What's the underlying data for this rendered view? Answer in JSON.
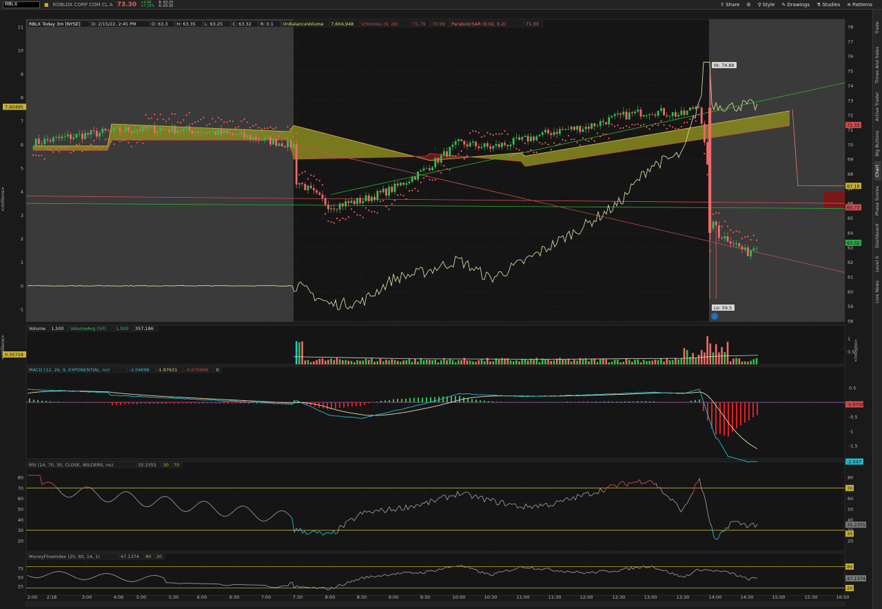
{
  "toolbar": {
    "symbol": "RBLX",
    "company": "ROBLOX CORP COM CL A",
    "last_price": "73.30",
    "change": "+4.98",
    "change_pct": "+7.29%",
    "bid": "B: 63.25",
    "ask": "A: 63.30",
    "buttons": [
      "Share",
      "Style",
      "Drawings",
      "Studies",
      "Patterns"
    ]
  },
  "sidebar": {
    "tabs": [
      "Trade",
      "Times And Sales",
      "Active Trader",
      "Big Buttons",
      "Chart",
      "Phase Scores",
      "Dashboard",
      "Level II",
      "Live News"
    ]
  },
  "price_panel": {
    "header": [
      "RBLX Today 3m [NYSE]",
      "D: 2/15/22, 2:45 PM",
      "O: 63.3",
      "H: 63.35",
      "L: 63.25",
      "C: 63.32",
      "R: 0.1",
      "OnBalanceVolume",
      "7,604,948",
      "Ichimoku (9, 26)",
      "71.79",
      "70.99",
      "ParabolicSAR (0.02, 0.2)",
      "71.33"
    ],
    "left_axis_label": "<millions>",
    "left_ticks": [
      "11",
      "10",
      "9",
      "8",
      "7",
      "6",
      "5",
      "4",
      "3",
      "2",
      "1",
      "0",
      "-1"
    ],
    "left_marker": "7.60495",
    "right_ticks": [
      "78",
      "77",
      "76",
      "75",
      "74",
      "73",
      "72",
      "71",
      "70",
      "69",
      "68",
      "67",
      "66",
      "65",
      "64",
      "63",
      "62",
      "61",
      "60",
      "59",
      "58"
    ],
    "right_markers": [
      {
        "label": "71.33",
        "color": "#d04a4a"
      },
      {
        "label": "67.19",
        "color": "#c8b230"
      },
      {
        "label": "65.73",
        "color": "#d04a4a"
      },
      {
        "label": "63.32",
        "color": "#2aa84a"
      }
    ],
    "hi_label": "Hi: 74.88",
    "lo_label": "Lo: 59.5"
  },
  "volume_panel": {
    "header": [
      "Volume",
      "1,500",
      "VolumeAvg (50)",
      "1,500",
      "357,186"
    ],
    "left_axis_label": "<millions>",
    "left_marker": "0.35719",
    "right_axis_label": "<millions>",
    "right_ticks": [
      "1",
      "0.5"
    ]
  },
  "macd_panel": {
    "header": [
      "MACD (12, 26, 9, EXPONENTIAL, no)",
      "-2.04698",
      "-1.97631",
      "-0.070666",
      "0"
    ],
    "right_ticks": [
      "0.5",
      "0",
      "-0.5",
      "-1",
      "-1.5",
      "-2"
    ],
    "right_markers": [
      {
        "label": "-0.0706",
        "color": "#d04a4a"
      },
      {
        "label": "-2.047",
        "color": "#27b6c8"
      }
    ]
  },
  "rsi_panel": {
    "header": [
      "RSI (14, 70, 30, CLOSE, WILDERS, no)",
      "35.2355",
      "30",
      "70"
    ],
    "right_ticks": [
      "80",
      "70",
      "60",
      "50",
      "40",
      "30",
      "20"
    ],
    "left_ticks": [
      "80",
      "70",
      "60",
      "50",
      "40",
      "30",
      "20"
    ],
    "right_markers": [
      {
        "label": "70",
        "color": "#c8b230"
      },
      {
        "label": "35.2355",
        "color": "#777777"
      },
      {
        "label": "30",
        "color": "#c8b230"
      }
    ]
  },
  "mfi_panel": {
    "header": [
      "MoneyFlowIndex (20, 80, 14, 1)",
      "47.1374",
      "80",
      "20"
    ],
    "left_ticks": [
      "75",
      "50",
      "25"
    ],
    "right_markers": [
      {
        "label": "80",
        "color": "#c8b230"
      },
      {
        "label": "47.1374",
        "color": "#777777"
      },
      {
        "label": "20",
        "color": "#c8b230"
      }
    ]
  },
  "time_axis": [
    "2:00",
    "2:18",
    "3:00",
    "4:06",
    "5:00",
    "5:30",
    "6:00",
    "6:30",
    "7:00",
    "7:30",
    "8:00",
    "8:30",
    "9:00",
    "9:30",
    "10:00",
    "10:30",
    "11:00",
    "11:30",
    "12:00",
    "12:30",
    "13:00",
    "13:30",
    "14:00",
    "14:30",
    "15:00",
    "15:30",
    "16:00"
  ],
  "chart_data": {
    "type": "line",
    "title": "RBLX Today 3m [NYSE]",
    "x": [
      "7:30",
      "8:00",
      "8:30",
      "9:00",
      "9:30",
      "10:00",
      "10:30",
      "11:00",
      "11:30",
      "12:00",
      "12:30",
      "13:00",
      "13:30",
      "13:45",
      "14:00",
      "14:15",
      "14:30",
      "14:40"
    ],
    "series": [
      {
        "name": "Price close",
        "values": [
          67.5,
          65.8,
          66.2,
          67.0,
          68.3,
          70.1,
          69.8,
          70.3,
          70.9,
          71.2,
          71.9,
          72.3,
          72.0,
          72.8,
          64.0,
          63.5,
          62.6,
          63.32
        ]
      },
      {
        "name": "OnBalanceVolume (millions)",
        "values": [
          0.0,
          -0.8,
          -0.7,
          0.3,
          0.6,
          1.1,
          0.3,
          1.0,
          1.8,
          2.6,
          3.5,
          5.1,
          5.6,
          7.9,
          7.7,
          7.6,
          7.7,
          7.605
        ]
      },
      {
        "name": "RSI",
        "values": [
          30,
          25,
          46,
          50,
          55,
          65,
          58,
          52,
          55,
          64,
          73,
          78,
          48,
          79,
          18,
          38,
          35,
          35.2355
        ]
      },
      {
        "name": "MACD",
        "values": [
          0.05,
          -0.45,
          -0.55,
          -0.3,
          -0.05,
          0.3,
          0.25,
          0.2,
          0.22,
          0.26,
          0.3,
          0.35,
          0.3,
          0.45,
          -1.2,
          -1.9,
          -2.05,
          -2.04698
        ]
      },
      {
        "name": "MoneyFlowIndex",
        "values": [
          22,
          18,
          48,
          60,
          64,
          84,
          56,
          80,
          70,
          62,
          70,
          82,
          50,
          72,
          68,
          62,
          45,
          47.1374
        ]
      }
    ],
    "hi": 74.88,
    "lo": 59.5,
    "ylim_price": [
      58,
      78
    ],
    "ylim_obv": [
      -1.5,
      11.5
    ]
  }
}
